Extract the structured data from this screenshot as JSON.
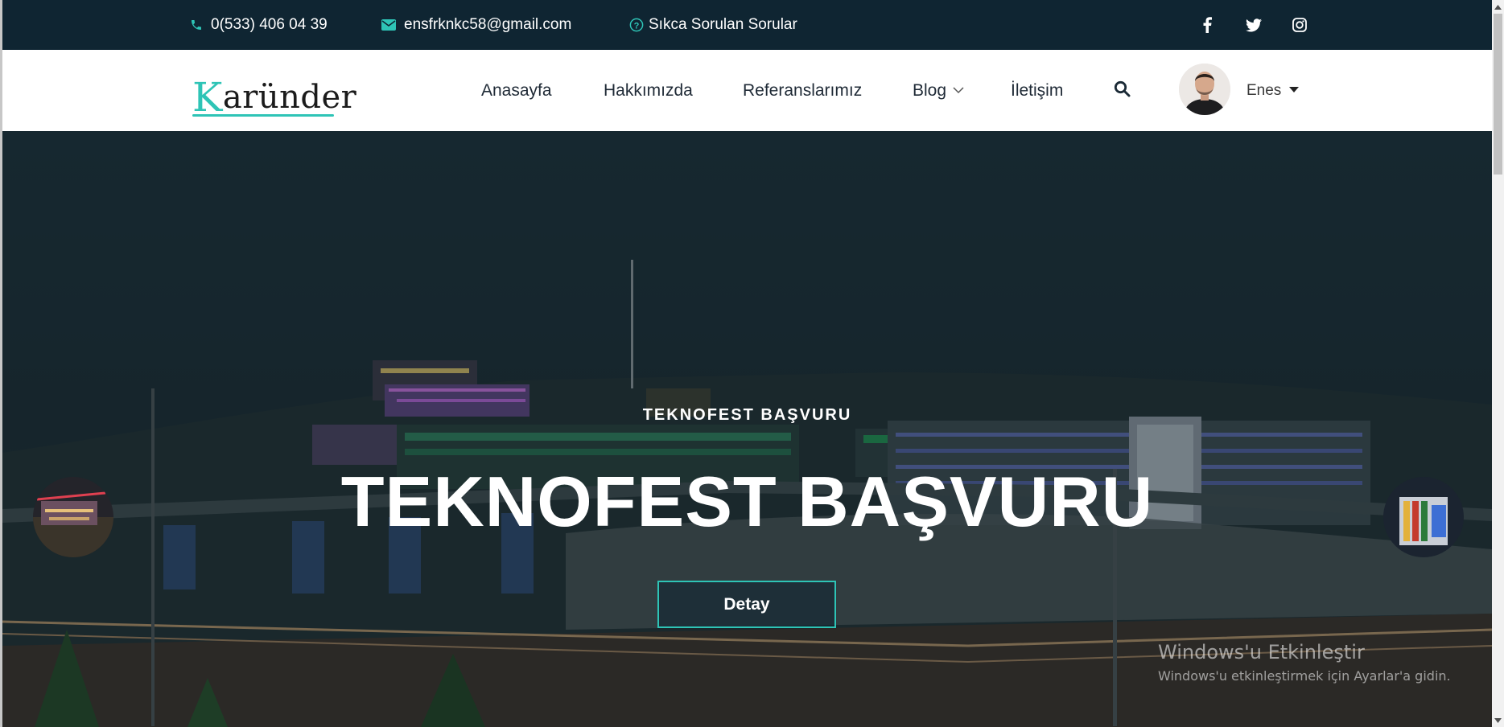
{
  "topbar": {
    "phone": "0(533) 406 04 39",
    "email": "ensfrknkc58@gmail.com",
    "faq": "Sıkca Sorulan Sorular",
    "social": [
      "facebook-icon",
      "twitter-icon",
      "instagram-icon"
    ]
  },
  "logo": {
    "first_letter": "K",
    "rest": "aründer"
  },
  "nav": {
    "items": [
      "Anasayfa",
      "Hakkımızda",
      "Referanslarımız",
      "Blog",
      "İletişim"
    ],
    "user_name": "Enes"
  },
  "hero": {
    "subtitle": "TEKNOFEST BAŞVURU",
    "title": "TEKNOFEST BAŞVURU",
    "button": "Detay"
  },
  "watermark": {
    "title": "Windows'u Etkinleştir",
    "subtitle": "Windows'u etkinleştirmek için Ayarlar'a gidin."
  },
  "colors": {
    "accent": "#2ec4b6",
    "topbar_bg": "#0f2532",
    "nav_text": "#1f2a36"
  }
}
